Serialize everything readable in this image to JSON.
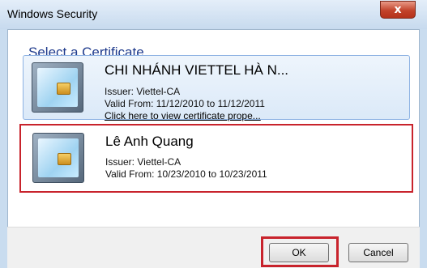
{
  "window": {
    "title": "Windows Security",
    "close_glyph": "x"
  },
  "dialog": {
    "heading": "Select a Certificate"
  },
  "certificates": [
    {
      "name": "CHI NHÁNH VIETTEL HÀ N...",
      "issuer": "Issuer: Viettel-CA",
      "valid": "Valid From: 11/12/2010 to 11/12/2011",
      "link": "Click here to view certificate prope...",
      "selected": true
    },
    {
      "name": "Lê Anh Quang",
      "issuer": "Issuer: Viettel-CA",
      "valid": "Valid From: 10/23/2010 to 10/23/2011",
      "highlighted": true
    }
  ],
  "buttons": {
    "ok": "OK",
    "cancel": "Cancel"
  },
  "colors": {
    "highlight_box": "#c8232c",
    "heading": "#1e3a8c",
    "selection": "#dbe9f8"
  },
  "icons": {
    "certificate": "smartcard-certificate-icon",
    "close": "close-icon"
  }
}
